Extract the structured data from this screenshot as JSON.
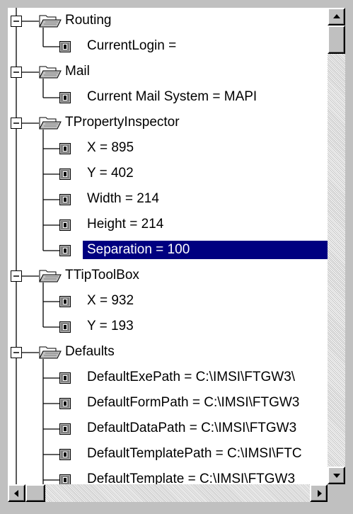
{
  "tree": {
    "items": [
      {
        "label": "Routing",
        "kind": "folder"
      },
      {
        "label": "CurrentLogin =",
        "kind": "property"
      },
      {
        "label": "Mail",
        "kind": "folder"
      },
      {
        "label": "Current Mail System = MAPI",
        "kind": "property"
      },
      {
        "label": "TPropertyInspector",
        "kind": "folder"
      },
      {
        "label": "X = 895",
        "kind": "property"
      },
      {
        "label": "Y = 402",
        "kind": "property"
      },
      {
        "label": "Width = 214",
        "kind": "property"
      },
      {
        "label": "Height = 214",
        "kind": "property"
      },
      {
        "label": "Separation = 100",
        "kind": "property",
        "selected": true
      },
      {
        "label": "TTipToolBox",
        "kind": "folder"
      },
      {
        "label": "X = 932",
        "kind": "property"
      },
      {
        "label": "Y = 193",
        "kind": "property"
      },
      {
        "label": "Defaults",
        "kind": "folder"
      },
      {
        "label": "DefaultExePath = C:\\IMSI\\FTGW3\\",
        "kind": "property"
      },
      {
        "label": "DefaultFormPath = C:\\IMSI\\FTGW3",
        "kind": "property"
      },
      {
        "label": "DefaultDataPath = C:\\IMSI\\FTGW3",
        "kind": "property"
      },
      {
        "label": "DefaultTemplatePath = C:\\IMSI\\FTC",
        "kind": "property"
      },
      {
        "label": "DefaultTemplate = C:\\IMSI\\FTGW3",
        "kind": "property"
      }
    ]
  },
  "icons": {
    "folder": "open-folder-icon",
    "property": "property-value-icon"
  },
  "colors": {
    "selection": "#000080",
    "window": "#c0c0c0"
  }
}
